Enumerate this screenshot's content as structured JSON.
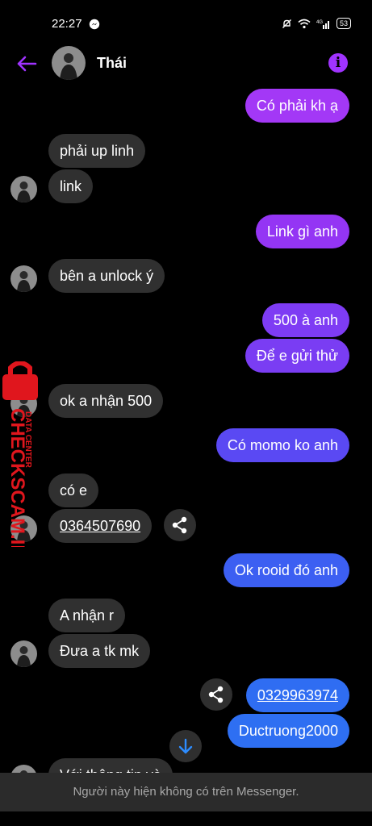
{
  "status_bar": {
    "time": "22:27",
    "battery": "53",
    "icons": [
      "messenger-icon",
      "mute-icon",
      "wifi-icon",
      "4g-signal-icon",
      "battery-icon"
    ]
  },
  "header": {
    "contact_name": "Thái",
    "back_icon": "back-arrow-icon",
    "info_icon": "info-icon",
    "accent": "#a033ff"
  },
  "messages": [
    {
      "dir": "out",
      "text": "Có phải kh ạ"
    },
    {
      "dir": "in",
      "text": "phải up linh"
    },
    {
      "dir": "in",
      "text": "link"
    },
    {
      "dir": "out",
      "text": "Link gì anh"
    },
    {
      "dir": "in",
      "text": "bên a unlock ý"
    },
    {
      "dir": "out",
      "text": "500 à anh"
    },
    {
      "dir": "out",
      "text": "Để e gửi thử"
    },
    {
      "dir": "in",
      "text": "ok a nhận 500"
    },
    {
      "dir": "out",
      "text": "Có momo ko anh"
    },
    {
      "dir": "in",
      "text": "có e"
    },
    {
      "dir": "in",
      "text": "0364507690",
      "link": true
    },
    {
      "dir": "out",
      "text": "Ok rooid đó anh"
    },
    {
      "dir": "in",
      "text": "A nhận r"
    },
    {
      "dir": "in",
      "text": "Đưa a tk mk"
    },
    {
      "dir": "out",
      "text": "0329963974",
      "link": true
    },
    {
      "dir": "out",
      "text": "Ductruong2000"
    },
    {
      "dir": "in",
      "text": "Với thông tin và"
    }
  ],
  "footer": {
    "notice": "Người này hiện không có trên Messenger."
  },
  "watermark": {
    "brand": "CHECKSCAM.INFO",
    "tagline": "DATA CENTER",
    "color": "#e0161d"
  },
  "colors": {
    "outgoing_purple": "#9b33f3",
    "outgoing_blue": "#3a63f2",
    "incoming": "#303030"
  }
}
